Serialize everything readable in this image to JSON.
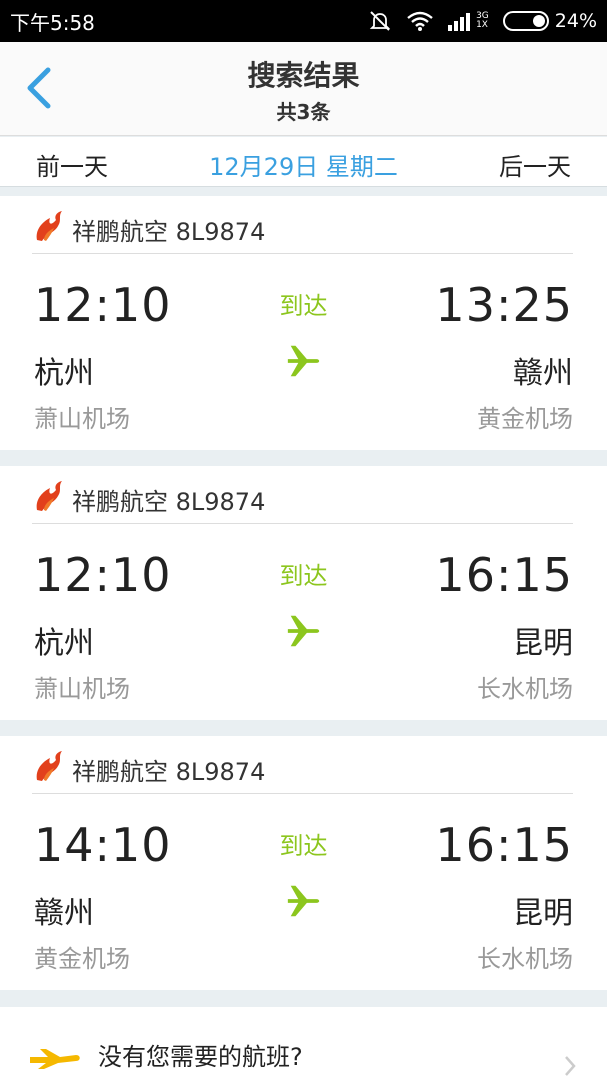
{
  "status_bar": {
    "time": "下午5:58",
    "network_top": "3G",
    "network_bottom": "1X",
    "battery": "24%"
  },
  "header": {
    "title": "搜索结果",
    "subtitle": "共3条"
  },
  "date_bar": {
    "prev": "前一天",
    "current": "12月29日 星期二",
    "next": "后一天"
  },
  "flights": [
    {
      "airline": "祥鹏航空 8L9874",
      "dep_time": "12:10",
      "arr_time": "13:25",
      "status": "到达",
      "dep_city": "杭州",
      "arr_city": "赣州",
      "dep_airport": "萧山机场",
      "arr_airport": "黄金机场"
    },
    {
      "airline": "祥鹏航空 8L9874",
      "dep_time": "12:10",
      "arr_time": "16:15",
      "status": "到达",
      "dep_city": "杭州",
      "arr_city": "昆明",
      "dep_airport": "萧山机场",
      "arr_airport": "长水机场"
    },
    {
      "airline": "祥鹏航空 8L9874",
      "dep_time": "14:10",
      "arr_time": "16:15",
      "status": "到达",
      "dep_city": "赣州",
      "arr_city": "昆明",
      "dep_airport": "黄金机场",
      "arr_airport": "长水机场"
    }
  ],
  "footer": {
    "no_flight_text": "没有您需要的航班?"
  },
  "colors": {
    "accent_blue": "#3aa0e0",
    "accent_green": "#8cc61e",
    "airline_red": "#e2401c",
    "plane_yellow": "#f5b800"
  },
  "icons": {
    "back": "chevron-left-icon",
    "airline": "flame-logo-icon",
    "plane": "airplane-icon",
    "mute": "mute-icon",
    "wifi": "wifi-icon",
    "signal": "signal-icon",
    "battery": "battery-icon"
  }
}
